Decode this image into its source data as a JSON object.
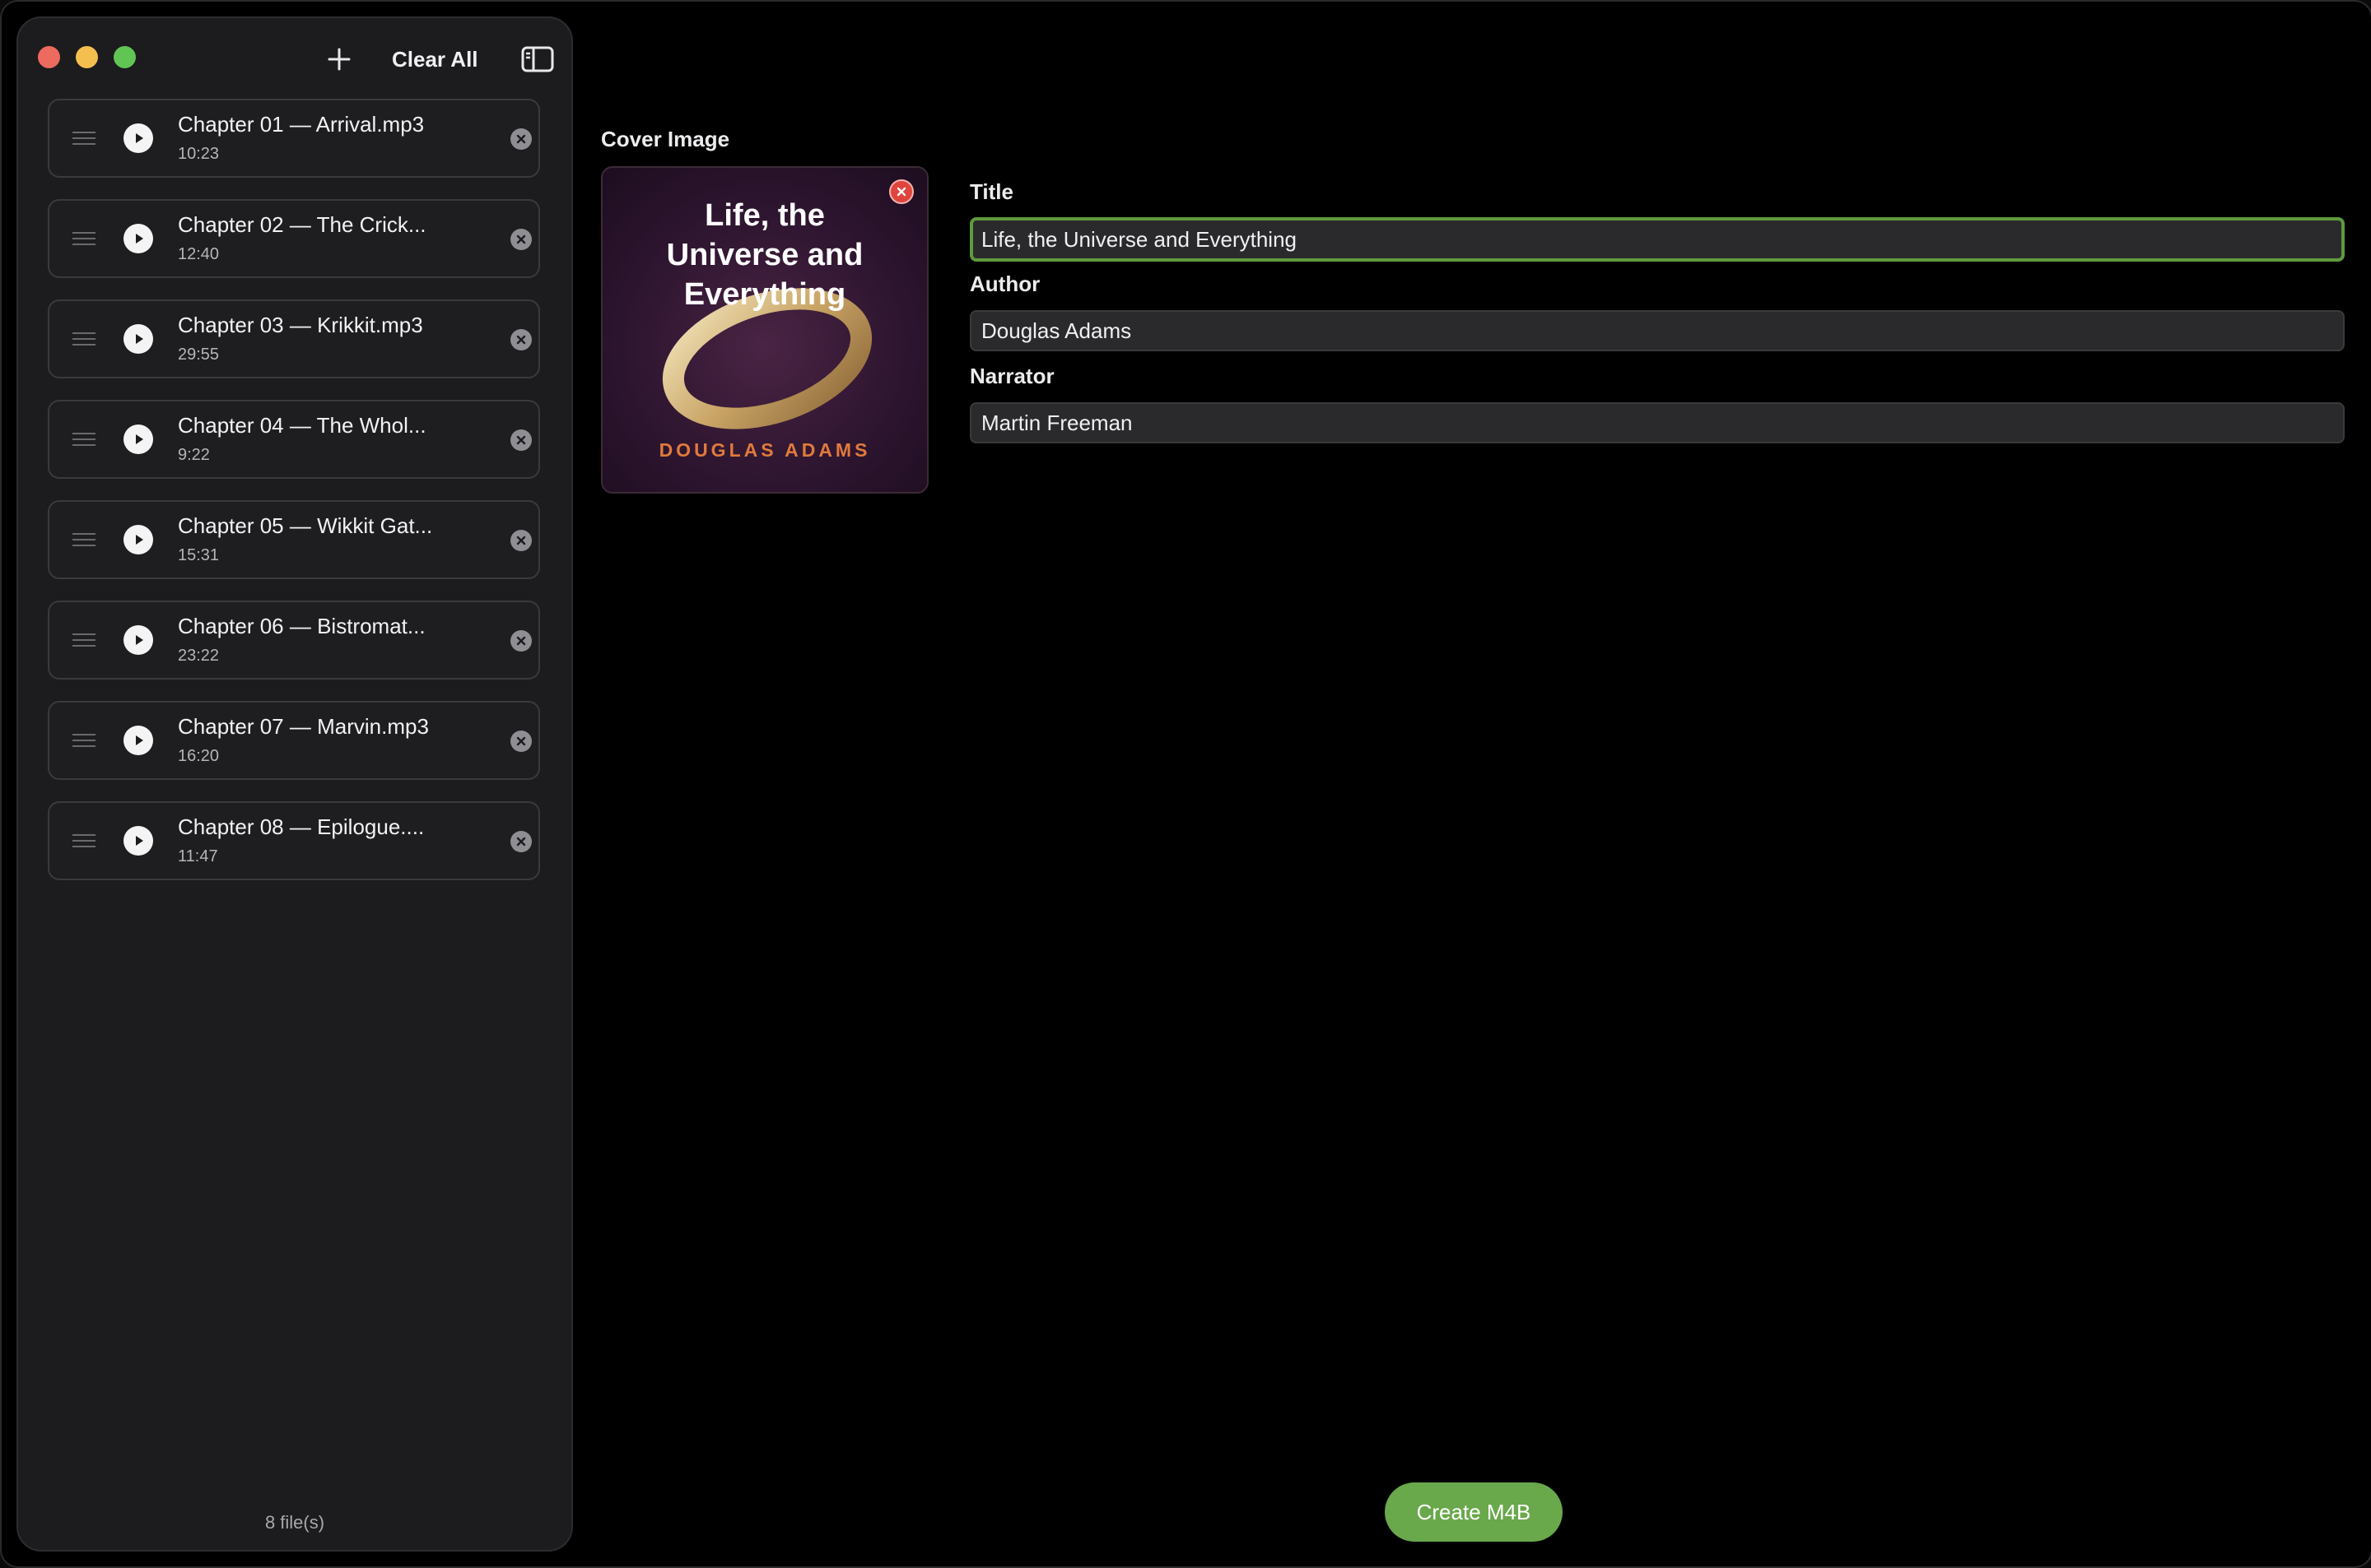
{
  "sidebar": {
    "clear_all_label": "Clear All",
    "file_count": "8 file(s)",
    "files": [
      {
        "name": "Chapter 01 — Arrival.mp3",
        "duration": "10:23"
      },
      {
        "name": "Chapter 02 — The Crick...",
        "duration": "12:40"
      },
      {
        "name": "Chapter 03 — Krikkit.mp3",
        "duration": "29:55"
      },
      {
        "name": "Chapter 04 — The Whol...",
        "duration": "9:22"
      },
      {
        "name": "Chapter 05 — Wikkit Gat...",
        "duration": "15:31"
      },
      {
        "name": "Chapter 06 — Bistromat...",
        "duration": "23:22"
      },
      {
        "name": "Chapter 07 — Marvin.mp3",
        "duration": "16:20"
      },
      {
        "name": "Chapter 08 — Epilogue....",
        "duration": "11:47"
      }
    ]
  },
  "cover": {
    "label": "Cover Image",
    "title_line1": "Life, the",
    "title_line2": "Universe and",
    "title_line3": "Everything",
    "author": "DOUGLAS ADAMS"
  },
  "form": {
    "title_label": "Title",
    "title_value": "Life, the Universe and Everything",
    "author_label": "Author",
    "author_value": "Douglas Adams",
    "narrator_label": "Narrator",
    "narrator_value": "Martin Freeman"
  },
  "actions": {
    "create_label": "Create M4B"
  },
  "colors": {
    "accent_green": "#69a84b",
    "focus_ring": "#5f9a3e",
    "cover_author": "#e07a3c"
  }
}
